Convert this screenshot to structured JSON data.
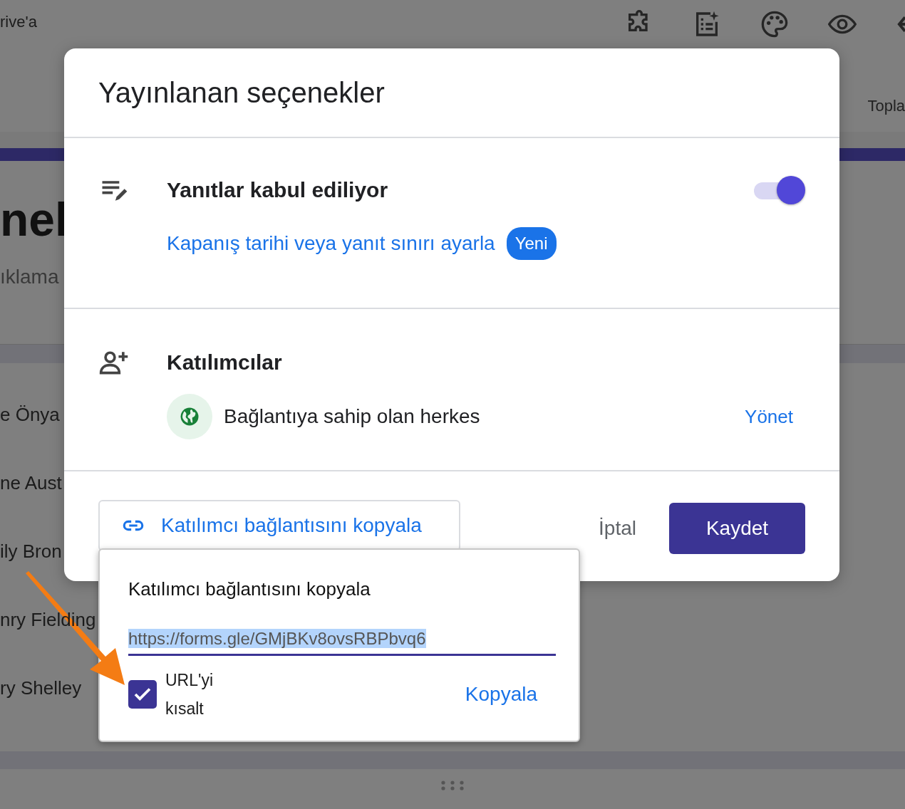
{
  "background": {
    "top_bar": {
      "drive_text": "rive'a",
      "right_tab": "Topla"
    },
    "form_title": "nel",
    "form_description": "ıklama",
    "list_items": [
      "e Önya",
      "ne Aust",
      "ily Bron",
      "nry Fielding",
      "ry Shelley"
    ]
  },
  "dialog": {
    "title": "Yayınlanan seçenekler",
    "responses": {
      "label": "Yanıtlar kabul ediliyor",
      "on": true,
      "link": "Kapanış tarihi veya yanıt sınırı ayarla",
      "badge": "Yeni"
    },
    "participants": {
      "label": "Katılımcılar",
      "access": "Bağlantıya sahip olan herkes",
      "manage": "Yönet"
    },
    "copy_button": "Katılımcı bağlantısını kopyala",
    "cancel": "İptal",
    "save": "Kaydet"
  },
  "popup": {
    "title": "Katılımcı bağlantısını kopyala",
    "url": "https://forms.gle/GMjBKv8ovsRBPbvq6",
    "shorten": {
      "label": "URL'yi kısalt",
      "checked": true
    },
    "copy": "Kopyala"
  }
}
